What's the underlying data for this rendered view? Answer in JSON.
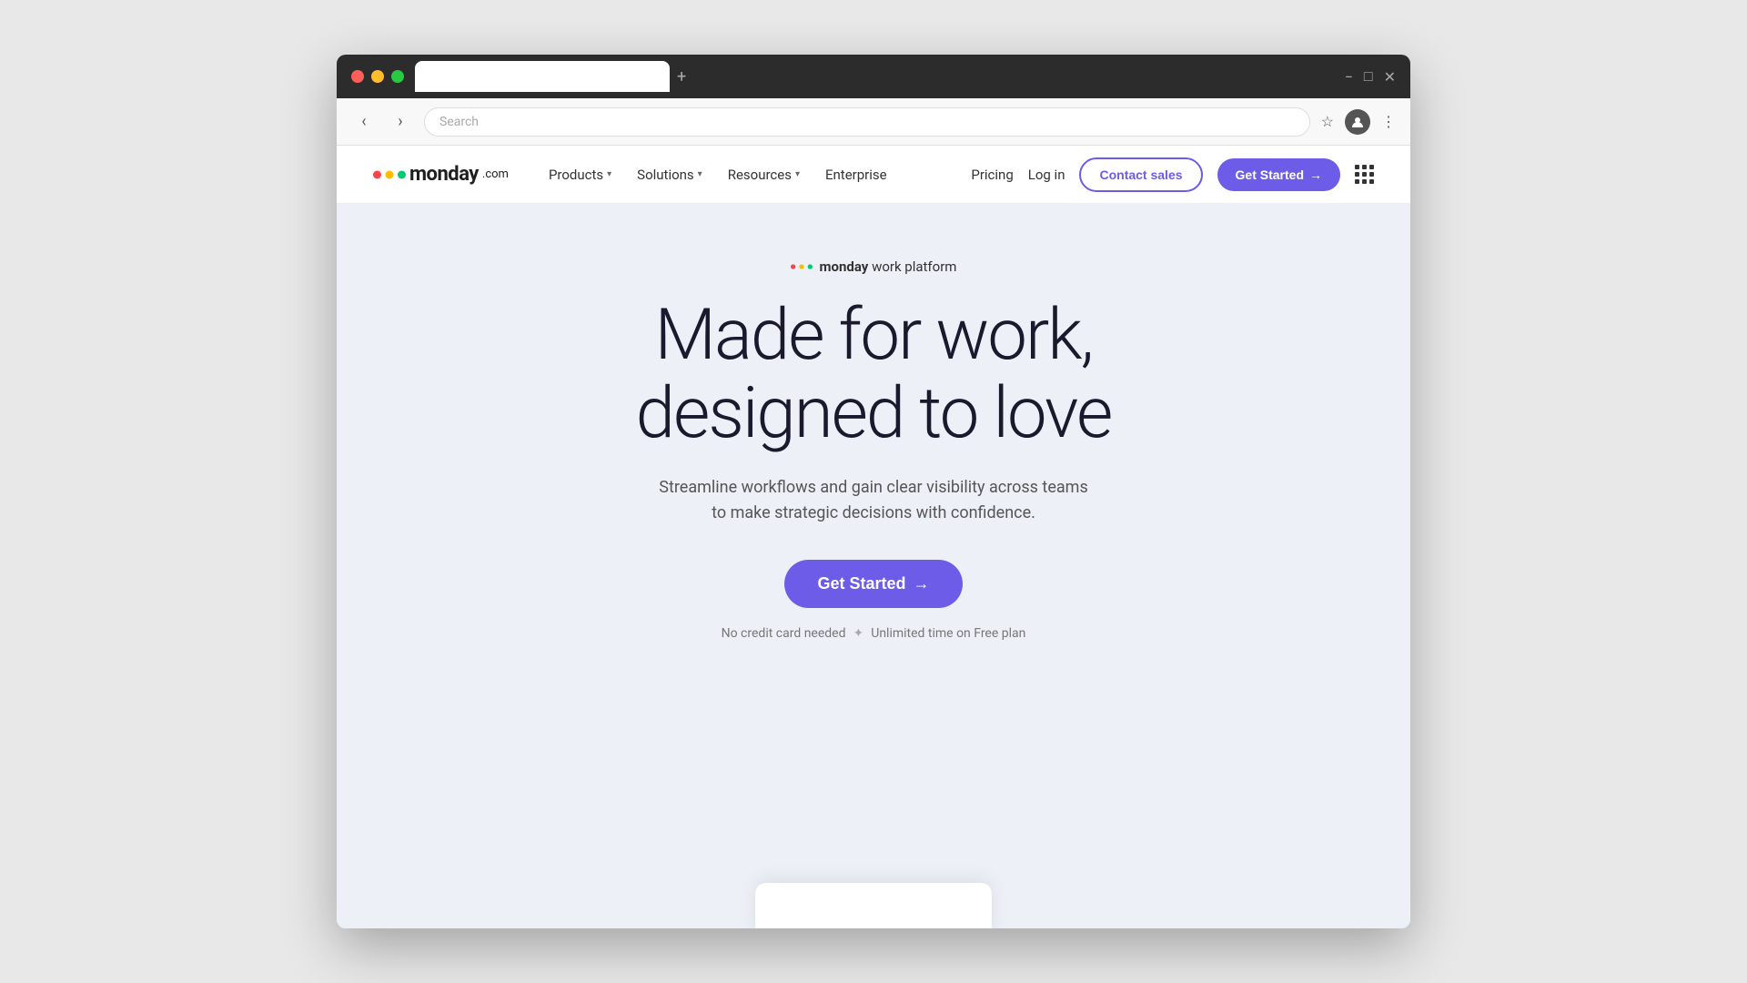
{
  "browser": {
    "tab_title": "",
    "address_placeholder": "Search",
    "new_tab_label": "+",
    "win_minimize": "−",
    "win_maximize": "□",
    "win_close": "✕",
    "back_arrow": "‹",
    "forward_arrow": "›",
    "star_icon": "☆",
    "menu_icon": "⋮"
  },
  "nav": {
    "logo_text": "monday",
    "logo_com": ".com",
    "products_label": "Products",
    "solutions_label": "Solutions",
    "resources_label": "Resources",
    "enterprise_label": "Enterprise",
    "pricing_label": "Pricing",
    "login_label": "Log in",
    "contact_sales_label": "Contact sales",
    "get_started_label": "Get Started",
    "get_started_arrow": "→"
  },
  "hero": {
    "badge_brand": "monday",
    "badge_suffix": " work platform",
    "title_line1": "Made for work,",
    "title_line2": "designed to love",
    "subtitle_line1": "Streamline workflows and gain clear visibility across teams",
    "subtitle_line2": "to make strategic decisions with confidence.",
    "cta_label": "Get Started",
    "cta_arrow": "→",
    "footnote_part1": "No credit card needed",
    "footnote_sep": "✦",
    "footnote_part2": "Unlimited time on Free plan"
  }
}
